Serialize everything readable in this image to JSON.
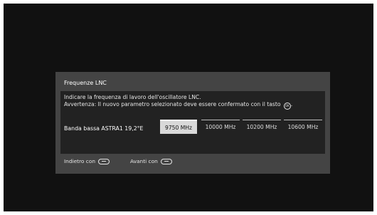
{
  "dialog": {
    "title": "Frequenze LNC",
    "description_line1": "Indicare la frequenza di lavoro dell'oscillatore LNC.",
    "description_line2": "Avvertenza: Il nuovo parametro selezionato deve essere confermato con il tasto",
    "description_line2_end": ".",
    "ok_key_label": "OK",
    "setting_label": "Banda bassa ASTRA1 19,2°E",
    "options": [
      "9750 MHz",
      "10000 MHz",
      "10200 MHz",
      "10600 MHz"
    ],
    "selected_option": "9750 MHz"
  },
  "footer": {
    "back_label": "Indietro con",
    "back_key_icon": "back-key-icon",
    "next_label": "Avanti con",
    "next_key_icon": "forward-key-icon"
  },
  "colors": {
    "screen_bg": "#111111",
    "dialog_bg": "#444444",
    "content_bg": "#222222",
    "selected_option_bg": "#d9d9d9"
  }
}
